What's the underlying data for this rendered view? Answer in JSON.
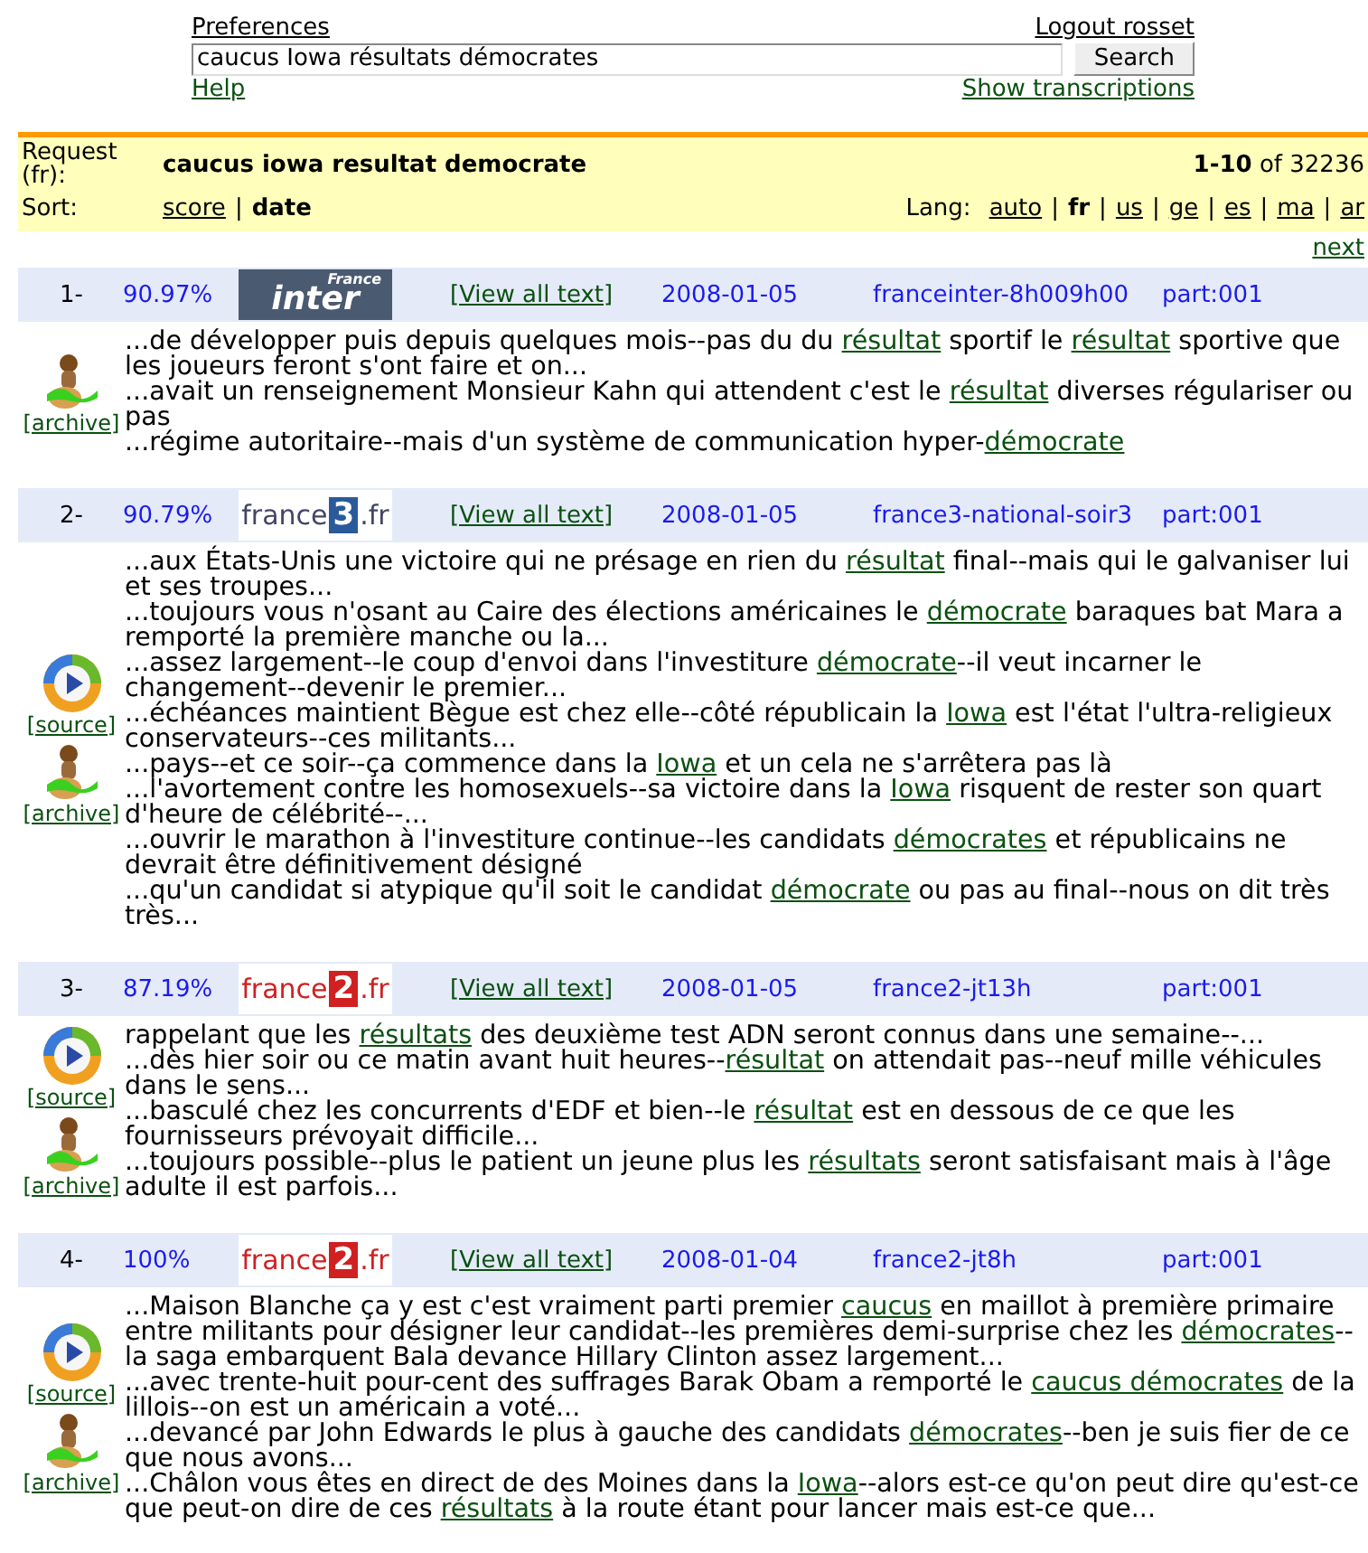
{
  "top": {
    "preferences": "Preferences",
    "logout": "Logout rosset",
    "query": "caucus Iowa résultats démocrates",
    "search_button": "Search",
    "help": "Help",
    "show_transcriptions": "Show transcriptions"
  },
  "summary": {
    "request_label": "Request (fr):",
    "request": "caucus iowa resultat democrate",
    "range": "1-10",
    "of": "of 32236",
    "separator": "|",
    "sort_label": "Sort:",
    "sort_options": [
      {
        "label": "score",
        "selected": false
      },
      {
        "label": "date",
        "selected": true
      }
    ],
    "lang_label": "Lang:",
    "langs": [
      {
        "label": "auto",
        "selected": false
      },
      {
        "label": "fr",
        "selected": true
      },
      {
        "label": "us",
        "selected": false
      },
      {
        "label": "ge",
        "selected": false
      },
      {
        "label": "es",
        "selected": false
      },
      {
        "label": "ma",
        "selected": false
      },
      {
        "label": "ar",
        "selected": false
      }
    ],
    "next": "next"
  },
  "results": [
    {
      "rank": "1-",
      "score": "90.97%",
      "logo": {
        "kind": "inter",
        "parts": [
          "France",
          "inter"
        ]
      },
      "view_all": "[View all text]",
      "date": "2008-01-05",
      "source": "franceinter-8h009h00",
      "part": "part:001",
      "media": [
        {
          "kind": "archive",
          "label": "[archive]"
        }
      ],
      "snippets": [
        [
          {
            "text": "...de développer puis depuis quelques mois--pas du du ",
            "hl": false
          },
          {
            "text": "résultat",
            "hl": true
          },
          {
            "text": " sportif le ",
            "hl": false
          },
          {
            "text": "résultat",
            "hl": true
          },
          {
            "text": " sportive que les joueurs feront s'ont faire et on...",
            "hl": false
          }
        ],
        [
          {
            "text": "...avait un renseignement Monsieur Kahn qui attendent c'est le ",
            "hl": false
          },
          {
            "text": "résultat",
            "hl": true
          },
          {
            "text": " diverses régulariser ou pas",
            "hl": false
          }
        ],
        [
          {
            "text": "...régime autoritaire--mais d'un système de communication hyper-",
            "hl": false
          },
          {
            "text": "démocrate",
            "hl": true
          }
        ]
      ]
    },
    {
      "rank": "2-",
      "score": "90.79%",
      "logo": {
        "kind": "box",
        "parts": [
          "france",
          "3",
          ".fr"
        ]
      },
      "view_all": "[View all text]",
      "date": "2008-01-05",
      "source": "france3-national-soir3",
      "part": "part:001",
      "media": [
        {
          "kind": "source",
          "label": "[source]"
        },
        {
          "kind": "archive",
          "label": "[archive]"
        }
      ],
      "snippets": [
        [
          {
            "text": "...aux États-Unis une victoire qui ne présage en rien du ",
            "hl": false
          },
          {
            "text": "résultat",
            "hl": true
          },
          {
            "text": " final--mais qui le galvaniser lui et ses troupes...",
            "hl": false
          }
        ],
        [
          {
            "text": "...toujours vous n'osant au Caire des élections américaines le ",
            "hl": false
          },
          {
            "text": "démocrate",
            "hl": true
          },
          {
            "text": " baraques bat Mara a remporté la première manche ou la...",
            "hl": false
          }
        ],
        [
          {
            "text": "...assez largement--le coup d'envoi dans l'investiture ",
            "hl": false
          },
          {
            "text": "démocrate",
            "hl": true
          },
          {
            "text": "--il veut incarner le changement--devenir le premier...",
            "hl": false
          }
        ],
        [
          {
            "text": "...échéances maintient Bègue est chez elle--côté républicain la ",
            "hl": false
          },
          {
            "text": "Iowa",
            "hl": true
          },
          {
            "text": " est l'état l'ultra-religieux conservateurs--ces militants...",
            "hl": false
          }
        ],
        [
          {
            "text": "...pays--et ce soir--ça commence dans la ",
            "hl": false
          },
          {
            "text": "Iowa",
            "hl": true
          },
          {
            "text": " et un cela ne s'arrêtera pas là",
            "hl": false
          }
        ],
        [
          {
            "text": "...l'avortement contre les homosexuels--sa victoire dans la ",
            "hl": false
          },
          {
            "text": "Iowa",
            "hl": true
          },
          {
            "text": " risquent de rester son quart d'heure de célébrité--...",
            "hl": false
          }
        ],
        [
          {
            "text": "...ouvrir le marathon à l'investiture continue--les candidats ",
            "hl": false
          },
          {
            "text": "démocrates",
            "hl": true
          },
          {
            "text": " et républicains ne devrait être définitivement désigné",
            "hl": false
          }
        ],
        [
          {
            "text": "...qu'un candidat si atypique qu'il soit le candidat ",
            "hl": false
          },
          {
            "text": "démocrate",
            "hl": true
          },
          {
            "text": " ou pas au final--nous on dit très très...",
            "hl": false
          }
        ]
      ]
    },
    {
      "rank": "3-",
      "score": "87.19%",
      "logo": {
        "kind": "box",
        "parts": [
          "france",
          "2",
          ".fr"
        ]
      },
      "view_all": "[View all text]",
      "date": "2008-01-05",
      "source": "france2-jt13h",
      "part": "part:001",
      "media": [
        {
          "kind": "source",
          "label": "[source]"
        },
        {
          "kind": "archive",
          "label": "[archive]"
        }
      ],
      "snippets": [
        [
          {
            "text": "rappelant que les ",
            "hl": false
          },
          {
            "text": "résultats",
            "hl": true
          },
          {
            "text": " des deuxième test ADN seront connus dans une semaine--...",
            "hl": false
          }
        ],
        [
          {
            "text": "...dès hier soir ou ce matin avant huit heures--",
            "hl": false
          },
          {
            "text": "résultat",
            "hl": true
          },
          {
            "text": " on attendait pas--neuf mille véhicules dans le sens...",
            "hl": false
          }
        ],
        [
          {
            "text": "...basculé chez les concurrents d'EDF et bien--le ",
            "hl": false
          },
          {
            "text": "résultat",
            "hl": true
          },
          {
            "text": " est en dessous de ce que les fournisseurs prévoyait difficile...",
            "hl": false
          }
        ],
        [
          {
            "text": "...toujours possible--plus le patient un jeune plus les ",
            "hl": false
          },
          {
            "text": "résultats",
            "hl": true
          },
          {
            "text": " seront satisfaisant mais à l'âge adulte il est parfois...",
            "hl": false
          }
        ]
      ]
    },
    {
      "rank": "4-",
      "score": "100%",
      "logo": {
        "kind": "box",
        "parts": [
          "france",
          "2",
          ".fr"
        ]
      },
      "view_all": "[View all text]",
      "date": "2008-01-04",
      "source": "france2-jt8h",
      "part": "part:001",
      "media": [
        {
          "kind": "source",
          "label": "[source]"
        },
        {
          "kind": "archive",
          "label": "[archive]"
        }
      ],
      "snippets": [
        [
          {
            "text": "...Maison Blanche ça y est c'est vraiment parti premier ",
            "hl": false
          },
          {
            "text": "caucus",
            "hl": true
          },
          {
            "text": " en maillot à première primaire entre militants pour désigner leur candidat--les premières demi-surprise chez les ",
            "hl": false
          },
          {
            "text": "démocrates",
            "hl": true
          },
          {
            "text": "--la saga embarquent Bala devance Hillary Clinton assez largement...",
            "hl": false
          }
        ],
        [
          {
            "text": "...avec trente-huit pour-cent des suffrages Barak Obam a remporté le ",
            "hl": false
          },
          {
            "text": "caucus démocrates",
            "hl": true
          },
          {
            "text": " de la lillois--on est un américain a voté...",
            "hl": false
          }
        ],
        [
          {
            "text": "...devancé par John Edwards le plus à gauche des candidats ",
            "hl": false
          },
          {
            "text": "démocrates",
            "hl": true
          },
          {
            "text": "--ben je suis fier de ce que nous avons...",
            "hl": false
          }
        ],
        [
          {
            "text": "...Châlon vous êtes en direct de des Moines dans la ",
            "hl": false
          },
          {
            "text": "Iowa",
            "hl": true
          },
          {
            "text": "--alors est-ce qu'on peut dire qu'est-ce que peut-on dire de ces ",
            "hl": false
          },
          {
            "text": "résultats",
            "hl": true
          },
          {
            "text": " à la route étant pour lancer mais est-ce que...",
            "hl": false
          }
        ]
      ]
    }
  ]
}
